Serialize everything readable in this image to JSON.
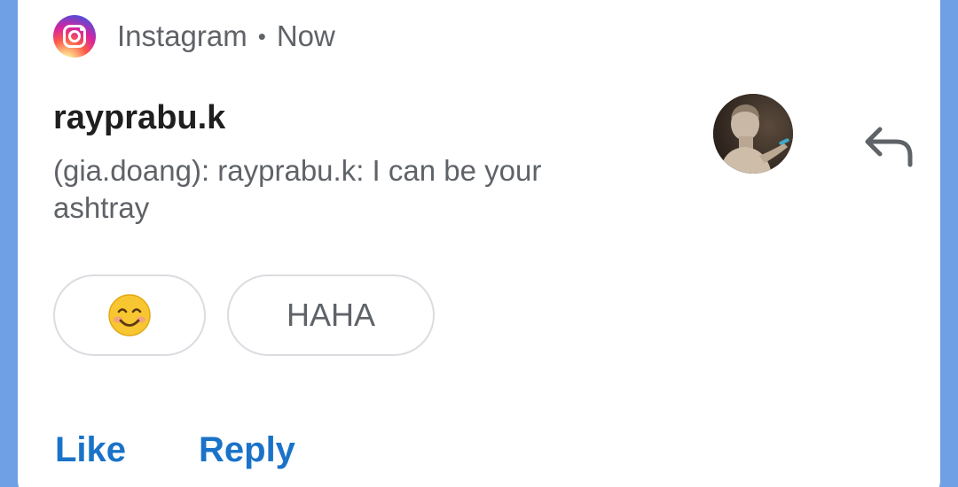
{
  "notification": {
    "app_name": "Instagram",
    "separator": "•",
    "time": "Now",
    "title": "rayprabu.k",
    "message": "(gia.doang): rayprabu.k: I can be your ashtray",
    "avatar_icon": "avatar-statue",
    "reply_icon": "reply-arrow-icon"
  },
  "quick_replies": [
    {
      "label": "😊",
      "icon": "smiling-face-emoji"
    },
    {
      "label": "HAHA"
    }
  ],
  "actions": {
    "like_label": "Like",
    "reply_label": "Reply"
  },
  "colors": {
    "background": "#6f9fe4",
    "card": "#ffffff",
    "action_blue": "#1a73c8",
    "secondary_text": "#5f6368",
    "title_text": "#1f1f1f"
  }
}
